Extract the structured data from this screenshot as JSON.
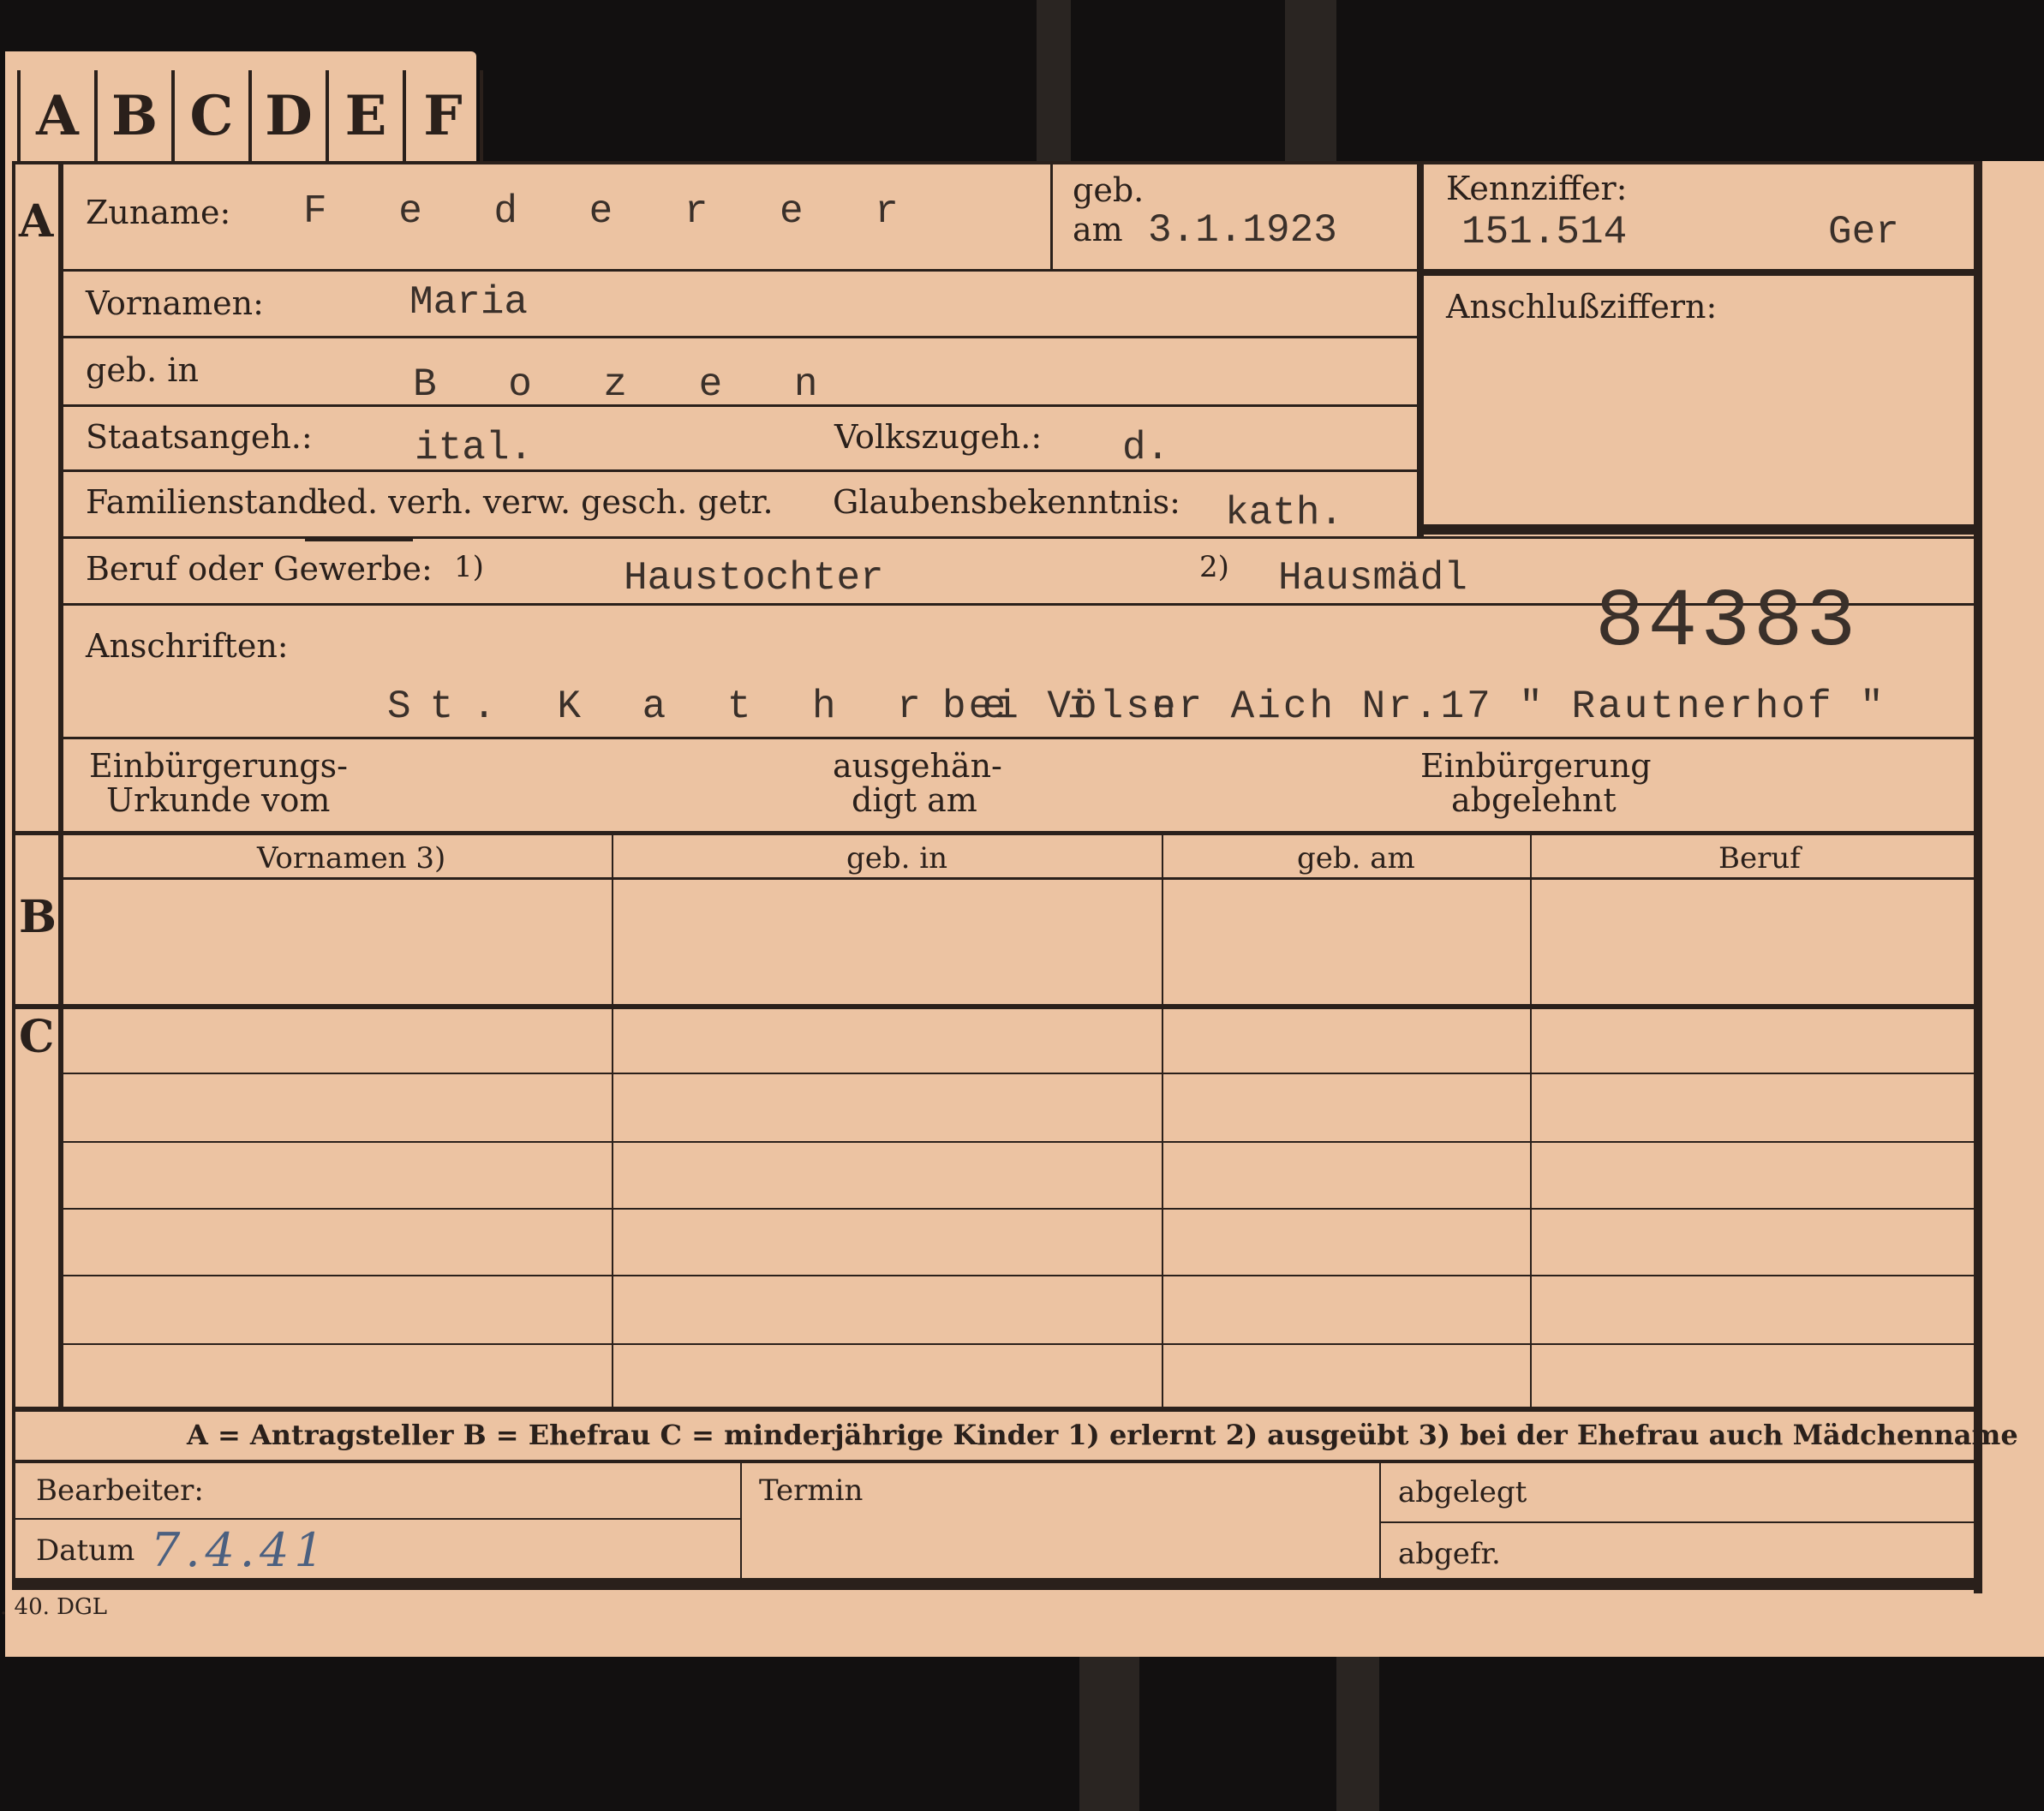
{
  "tabs": [
    "A",
    "B",
    "C",
    "D",
    "E",
    "F"
  ],
  "section_a": {
    "letter": "A",
    "zuname_label": "Zuname:",
    "zuname_value": "F e d e r e r",
    "geb_label": "geb.",
    "am_label": "am",
    "geb_am_value": "3.1.1923",
    "kennziffer_label": "Kennziffer:",
    "kennziffer_value": "151.514",
    "kennziffer_suffix": "Ger",
    "anschlussziffern_label": "Anschlußziffern:",
    "vornamen_label": "Vornamen:",
    "vornamen_value": "Maria",
    "geb_in_label": "geb. in",
    "geb_in_value": "B o z e n",
    "staatsangeh_label": "Staatsangeh.:",
    "staatsangeh_value": "ital.",
    "volkszugeh_label": "Volkszugeh.:",
    "volkszugeh_value": "d.",
    "familienstand_label": "Familienstand:",
    "familienstand_options": "led. verh. verw. gesch. getr.",
    "glaubens_label": "Glaubensbekenntnis:",
    "glaubens_value": "kath.",
    "beruf_label": "Beruf oder Gewerbe:",
    "beruf_note1": "1)",
    "beruf_value1": "Haustochter",
    "beruf_note2": "2)",
    "beruf_value2": "Hausmädl",
    "big_number": "84383",
    "anschriften_label": "Anschriften:",
    "anschrift_part1": "St. K a t h r e i n",
    "anschrift_part2": "bei Völser Aich Nr.17 \" Rautnerhof \"",
    "einb_urkunde_line1": "Einbürgerungs-",
    "einb_urkunde_line2": "Urkunde vom",
    "ausgehaendigt_line1": "ausgehän-",
    "ausgehaendigt_line2": "digt am",
    "einb_abgelehnt_line1": "Einbürgerung",
    "einb_abgelehnt_line2": "abgelehnt"
  },
  "section_b": {
    "letter": "B",
    "col_vornamen": "Vornamen 3)",
    "col_geb_in": "geb. in",
    "col_geb_am": "geb. am",
    "col_beruf": "Beruf"
  },
  "section_c": {
    "letter": "C"
  },
  "legend": "A = Antragsteller   B = Ehefrau   C = minderjährige Kinder   1) erlernt   2) ausgeübt   3) bei der Ehefrau auch Mädchenname",
  "footer": {
    "bearbeiter_label": "Bearbeiter:",
    "datum_label": "Datum",
    "datum_value": "7.4.41",
    "termin_label": "Termin",
    "abgelegt_label": "abgelegt",
    "abgefr_label": "abgefr.",
    "print_code": ". 40. DGL"
  }
}
